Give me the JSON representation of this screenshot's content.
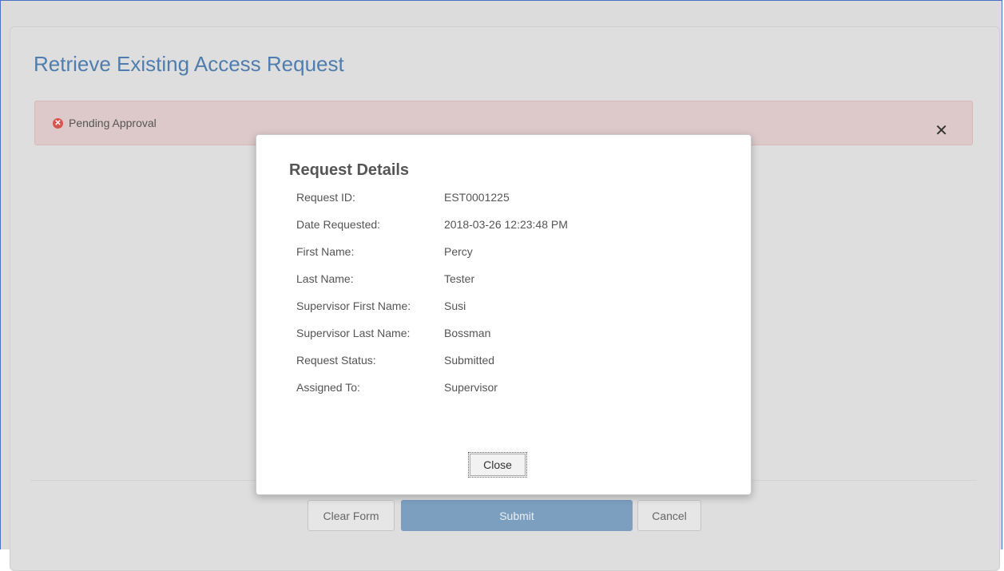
{
  "page": {
    "title": "Retrieve Existing Access Request",
    "alert": {
      "icon": "error-circle-icon",
      "text": "Pending Approval",
      "close_glyph": "✕",
      "color": "#d9534f"
    }
  },
  "actions": {
    "clear_label": "Clear Form",
    "submit_label": "Submit",
    "cancel_label": "Cancel"
  },
  "modal": {
    "title": "Request Details",
    "fields": [
      {
        "label": "Request ID:",
        "value": "EST0001225"
      },
      {
        "label": "Date Requested:",
        "value": "2018-03-26 12:23:48 PM"
      },
      {
        "label": "First Name:",
        "value": "Percy"
      },
      {
        "label": "Last Name:",
        "value": "Tester"
      },
      {
        "label": "Supervisor First Name:",
        "value": "Susi"
      },
      {
        "label": "Supervisor Last Name:",
        "value": "Bossman"
      },
      {
        "label": "Request Status:",
        "value": "Submitted"
      },
      {
        "label": "Assigned To:",
        "value": "Supervisor"
      }
    ],
    "close_label": "Close"
  },
  "colors": {
    "title": "#4f7eae",
    "alert_bg": "#ddc9c9",
    "submit_bg": "#7c9fc0"
  }
}
